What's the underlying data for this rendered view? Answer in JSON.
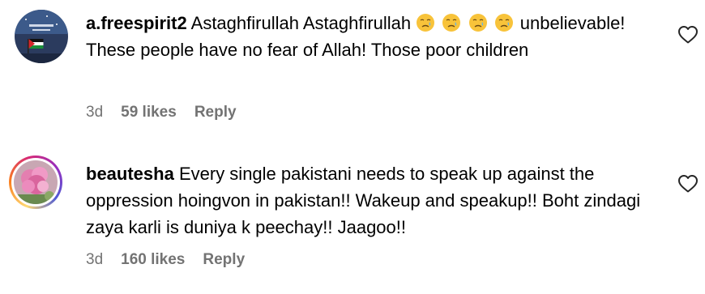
{
  "comments": [
    {
      "username": "a.freespirit2",
      "text_before": "Astaghfirullah Astaghfirullah",
      "emojis": [
        "crying-face",
        "crying-face",
        "crying-face",
        "crying-face"
      ],
      "text_after": "unbelievable! These people have no fear of Allah! Those poor children",
      "time": "3d",
      "likes": "59 likes",
      "reply": "Reply",
      "liked": false
    },
    {
      "username": "beautesha",
      "text": "Every single pakistani needs to speak up against the oppression hoingvon in pakistan!! Wakeup and speakup!! Boht zindagi zaya karli is duniya k peechay!! Jaagoo!!",
      "time": "3d",
      "likes": "160 likes",
      "reply": "Reply",
      "liked": false
    }
  ],
  "icons": {
    "like": "heart-outline-icon",
    "emoji": "crying-face"
  },
  "colors": {
    "meta": "#737373",
    "text": "#000000",
    "story_ring_start": "#feda75",
    "story_ring_end": "#962fbf"
  }
}
